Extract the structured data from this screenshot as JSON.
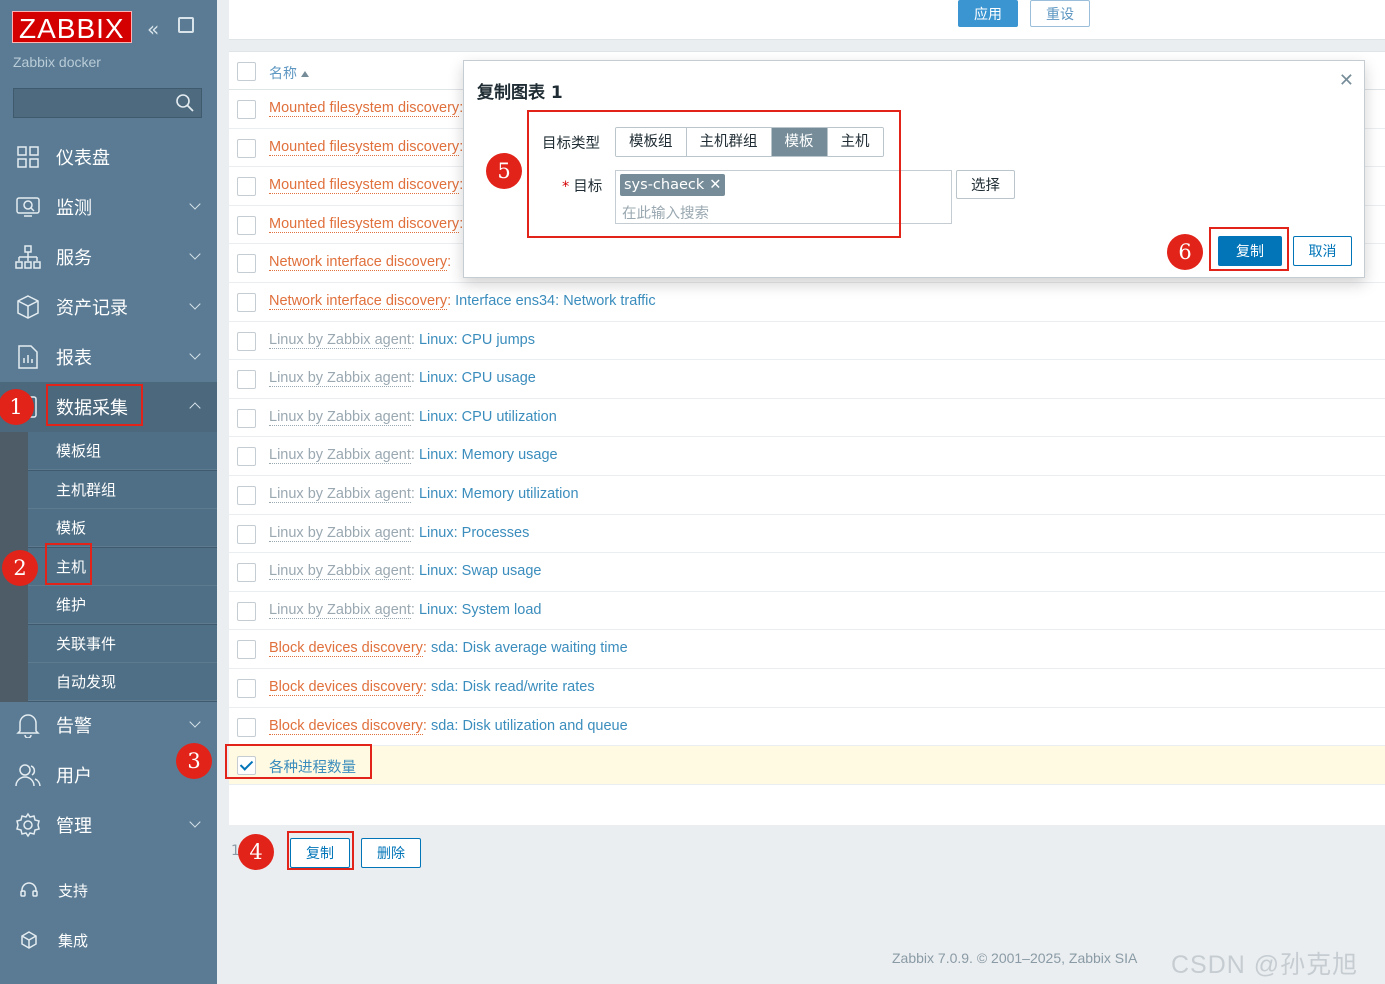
{
  "brand": {
    "logo": "ZABBIX",
    "server": "Zabbix docker"
  },
  "sidebar": {
    "menu": [
      {
        "label": "仪表盘",
        "icon": "dashboard-icon"
      },
      {
        "label": "监测",
        "icon": "monitor-icon"
      },
      {
        "label": "服务",
        "icon": "services-icon"
      },
      {
        "label": "资产记录",
        "icon": "inventory-icon"
      },
      {
        "label": "报表",
        "icon": "reports-icon"
      },
      {
        "label": "数据采集",
        "icon": "data-collection-icon"
      },
      {
        "label": "告警",
        "icon": "bell-icon"
      },
      {
        "label": "用户",
        "icon": "users-icon"
      },
      {
        "label": "管理",
        "icon": "gear-icon"
      }
    ],
    "submenu": [
      "模板组",
      "主机群组",
      "模板",
      "主机",
      "维护",
      "关联事件",
      "自动发现"
    ],
    "bottom": [
      {
        "label": "支持",
        "icon": "headset-icon"
      },
      {
        "label": "集成",
        "icon": "integrations-icon"
      }
    ]
  },
  "filter": {
    "apply": "应用",
    "reset": "重设"
  },
  "table": {
    "header": "名称",
    "rows": [
      {
        "prefix": "Mounted filesystem discovery",
        "prefix_type": "discovery",
        "host": "",
        "name": ""
      },
      {
        "prefix": "Mounted filesystem discovery",
        "prefix_type": "discovery",
        "host": "",
        "name": ""
      },
      {
        "prefix": "Mounted filesystem discovery",
        "prefix_type": "discovery",
        "host": "",
        "name": ""
      },
      {
        "prefix": "Mounted filesystem discovery",
        "prefix_type": "discovery",
        "host": "",
        "name": ""
      },
      {
        "prefix": "Network interface discovery",
        "prefix_type": "discovery",
        "host": "",
        "name": ""
      },
      {
        "prefix": "Network interface discovery",
        "prefix_type": "discovery",
        "host": "Interface ens34",
        "name": "Network traffic"
      },
      {
        "prefix": "Linux by Zabbix agent",
        "prefix_type": "template",
        "host": "Linux",
        "name": "CPU jumps"
      },
      {
        "prefix": "Linux by Zabbix agent",
        "prefix_type": "template",
        "host": "Linux",
        "name": "CPU usage"
      },
      {
        "prefix": "Linux by Zabbix agent",
        "prefix_type": "template",
        "host": "Linux",
        "name": "CPU utilization"
      },
      {
        "prefix": "Linux by Zabbix agent",
        "prefix_type": "template",
        "host": "Linux",
        "name": "Memory usage"
      },
      {
        "prefix": "Linux by Zabbix agent",
        "prefix_type": "template",
        "host": "Linux",
        "name": "Memory utilization"
      },
      {
        "prefix": "Linux by Zabbix agent",
        "prefix_type": "template",
        "host": "Linux",
        "name": "Processes"
      },
      {
        "prefix": "Linux by Zabbix agent",
        "prefix_type": "template",
        "host": "Linux",
        "name": "Swap usage"
      },
      {
        "prefix": "Linux by Zabbix agent",
        "prefix_type": "template",
        "host": "Linux",
        "name": "System load"
      },
      {
        "prefix": "Block devices discovery",
        "prefix_type": "discovery",
        "host": "sda",
        "name": "Disk average waiting time"
      },
      {
        "prefix": "Block devices discovery",
        "prefix_type": "discovery",
        "host": "sda",
        "name": "Disk read/write rates"
      },
      {
        "prefix": "Block devices discovery",
        "prefix_type": "discovery",
        "host": "sda",
        "name": "Disk utilization and queue"
      },
      {
        "prefix": "",
        "prefix_type": "none",
        "host": "",
        "name": "各种进程数量",
        "checked": true
      }
    ]
  },
  "mass_actions": {
    "count": "1",
    "copy": "复制",
    "delete": "删除"
  },
  "dialog": {
    "title": "复制图表 1",
    "target_type_label": "目标类型",
    "target_types": [
      "模板组",
      "主机群组",
      "模板",
      "主机"
    ],
    "selected_type": "模板",
    "target_label": "目标",
    "selected_target": "sys-chaeck",
    "search_placeholder": "在此输入搜索",
    "select_button": "选择",
    "copy_button": "复制",
    "cancel_button": "取消"
  },
  "annotations": [
    "1",
    "2",
    "3",
    "4",
    "5",
    "6"
  ],
  "footer": {
    "text": "Zabbix 7.0.9. © 2001–2025, Zabbix SIA",
    "watermark": "CSDN @孙克旭"
  },
  "colors": {
    "sidebar": "#5a7b93",
    "accent": "#0275b8",
    "annotation": "#e2231a",
    "discovery_prefix": "#e0703c"
  }
}
